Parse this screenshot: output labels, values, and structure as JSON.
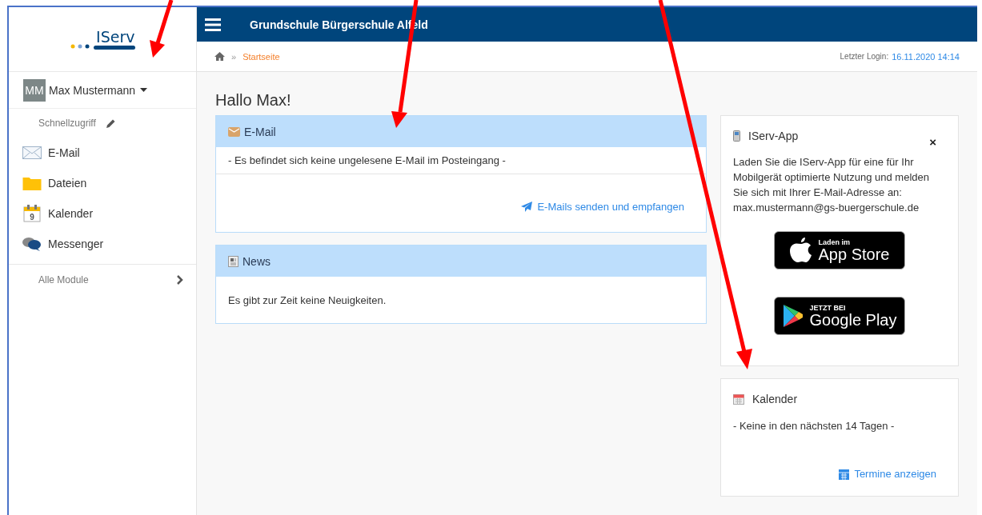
{
  "sidebar": {
    "logo": "IServ",
    "user": {
      "initials": "MM",
      "name": "Max Mustermann"
    },
    "quick_access_label": "Schnellzugriff",
    "items": [
      {
        "label": "E-Mail",
        "kind": "mail"
      },
      {
        "label": "Dateien",
        "kind": "folder"
      },
      {
        "label": "Kalender",
        "kind": "calendar",
        "day": "9"
      },
      {
        "label": "Messenger",
        "kind": "chat"
      }
    ],
    "all_modules": "Alle Module"
  },
  "topbar": {
    "title": "Grundschule Bürgerschule Alfeld"
  },
  "breadcrumb": {
    "current": "Startseite",
    "separator": "»",
    "last_login_label": "Letzter Login:",
    "last_login": "16.11.2020 14:14"
  },
  "greeting": "Hallo Max!",
  "email_panel": {
    "title": "E-Mail",
    "message": "- Es befindet sich keine ungelesene E-Mail im Posteingang -",
    "link": "E-Mails senden und empfangen"
  },
  "news_panel": {
    "title": "News",
    "message": "Es gibt zur Zeit keine Neuigkeiten."
  },
  "app_panel": {
    "title": "IServ-App",
    "close": "×",
    "text": "Laden Sie die IServ-App für eine für Ihr Mobilgerät optimierte Nutzung und melden Sie sich mit Ihrer E-Mail-Adresse an: max.mustermann@gs-buergerschule.de",
    "badges": [
      {
        "kind": "apple",
        "small": "Laden im",
        "big": "App Store"
      },
      {
        "kind": "google",
        "small": "JETZT BEI",
        "big": "Google Play"
      }
    ]
  },
  "calendar_panel": {
    "title": "Kalender",
    "message": "- Keine in den nächsten 14 Tagen -",
    "link": "Termine anzeigen"
  }
}
